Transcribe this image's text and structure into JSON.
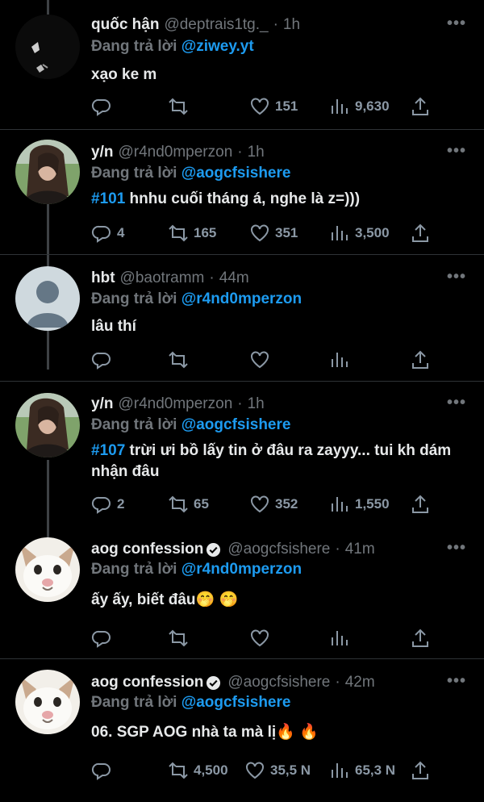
{
  "tweets": [
    {
      "name": "quốc hận",
      "handle": "@deptrais1tg._",
      "sep": "·",
      "time": "1h",
      "reply_label": "Đang trả lời",
      "reply_to": "@ziwey.yt",
      "text": "xạo ke m",
      "hashtag": "",
      "replies": "",
      "retweets": "",
      "likes": "151",
      "views": "9,630",
      "verified": false,
      "avatar": "dark-sketch"
    },
    {
      "name": "y/n",
      "handle": "@r4nd0mperzon",
      "sep": "·",
      "time": "1h",
      "reply_label": "Đang trả lời",
      "reply_to": "@aogcfsishere",
      "hashtag": "#101",
      "text": " hnhu cuối tháng á, nghe là z=)))",
      "replies": "4",
      "retweets": "165",
      "likes": "351",
      "views": "3,500",
      "verified": false,
      "avatar": "girl-photo"
    },
    {
      "name": "hbt",
      "handle": "@baotramm",
      "sep": "·",
      "time": "44m",
      "reply_label": "Đang trả lời",
      "reply_to": "@r4nd0mperzon",
      "hashtag": "",
      "text": "lâu thí",
      "replies": "",
      "retweets": "",
      "likes": "",
      "views": "",
      "verified": false,
      "avatar": "default-profile"
    },
    {
      "name": "y/n",
      "handle": "@r4nd0mperzon",
      "sep": "·",
      "time": "1h",
      "reply_label": "Đang trả lời",
      "reply_to": "@aogcfsishere",
      "hashtag": "#107",
      "text": " trừi ưi bồ lấy tin ở đâu ra zayyy... tui kh dám nhận đâu",
      "replies": "2",
      "retweets": "65",
      "likes": "352",
      "views": "1,550",
      "verified": false,
      "avatar": "girl-photo"
    },
    {
      "name": "aog confession",
      "handle": "@aogcfsishere",
      "sep": "·",
      "time": "41m",
      "reply_label": "Đang trả lời",
      "reply_to": "@r4nd0mperzon",
      "hashtag": "",
      "text": "ấy ấy, biết đâu🤭 🤭",
      "replies": "",
      "retweets": "",
      "likes": "",
      "views": "",
      "verified": true,
      "avatar": "cat-photo"
    },
    {
      "name": "aog confession",
      "handle": "@aogcfsishere",
      "sep": "·",
      "time": "42m",
      "reply_label": "Đang trả lời",
      "reply_to": "@aogcfsishere",
      "hashtag": "",
      "text": "06. SGP AOG nhà ta mà lị🔥 🔥",
      "replies": "",
      "retweets": "4,500",
      "likes": "35,5 N",
      "views": "65,3 N",
      "verified": true,
      "avatar": "cat-photo"
    }
  ],
  "more_label": "•••",
  "icons": {
    "reply": "reply-icon",
    "retweet": "retweet-icon",
    "like": "heart-icon",
    "views": "views-icon",
    "share": "share-icon",
    "more": "more-icon",
    "verified": "verified-badge-icon"
  },
  "colors": {
    "background": "#000000",
    "text": "#e7e9ea",
    "muted": "#71767b",
    "link": "#1d9bf0",
    "divider": "#2f3336"
  }
}
